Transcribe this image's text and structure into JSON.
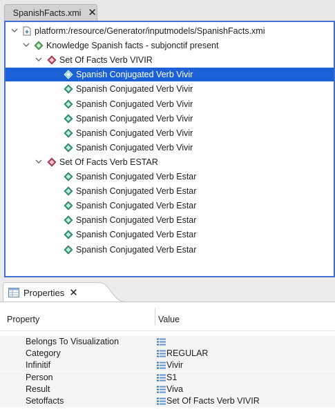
{
  "editor_tab": {
    "title": "SpanishFacts.xmi",
    "close_glyph": "✕"
  },
  "tree": {
    "root_label": "platform:/resource/Generator/inputmodels/SpanishFacts.xmi",
    "knowledge_label": "Knowledge Spanish facts - subjonctif present",
    "sets": [
      {
        "label": "Set Of Facts Verb VIVIR",
        "children": [
          "Spanish Conjugated Verb Vivir",
          "Spanish Conjugated Verb Vivir",
          "Spanish Conjugated Verb Vivir",
          "Spanish Conjugated Verb Vivir",
          "Spanish Conjugated Verb Vivir",
          "Spanish Conjugated Verb Vivir"
        ]
      },
      {
        "label": "Set Of Facts Verb ESTAR",
        "children": [
          "Spanish Conjugated Verb Estar",
          "Spanish Conjugated Verb Estar",
          "Spanish Conjugated Verb Estar",
          "Spanish Conjugated Verb Estar",
          "Spanish Conjugated Verb Estar",
          "Spanish Conjugated Verb Estar"
        ]
      }
    ],
    "selected_item": "Spanish Conjugated Verb Vivir (1st child of VIVIR set)"
  },
  "properties": {
    "tab_title": "Properties",
    "close_glyph": "✕",
    "columns": {
      "property": "Property",
      "value": "Value"
    },
    "rows": [
      {
        "name": "Belongs To Visualization",
        "value": ""
      },
      {
        "name": "Category",
        "value": "REGULAR"
      },
      {
        "name": "Infinitif",
        "value": "Vivir"
      },
      {
        "name": "Person",
        "value": "S1"
      },
      {
        "name": "Result",
        "value": "Viva"
      },
      {
        "name": "Setoffacts",
        "value": "Set Of Facts Verb VIVIR"
      }
    ]
  },
  "colors": {
    "selection": "#1c62d6",
    "focus_border": "#3e6fd3",
    "fact_icon": "#3a9a82",
    "set_icon": "#b5475e",
    "knowledge_icon": "#52a05a"
  },
  "icons": {
    "editor_tab": "model-file-icon",
    "root": "resource-file-icon",
    "knowledge": "knowledge-diamond-icon",
    "set": "set-diamond-icon",
    "fact": "fact-diamond-icon",
    "properties_tab": "properties-table-icon",
    "value": "property-value-icon"
  }
}
